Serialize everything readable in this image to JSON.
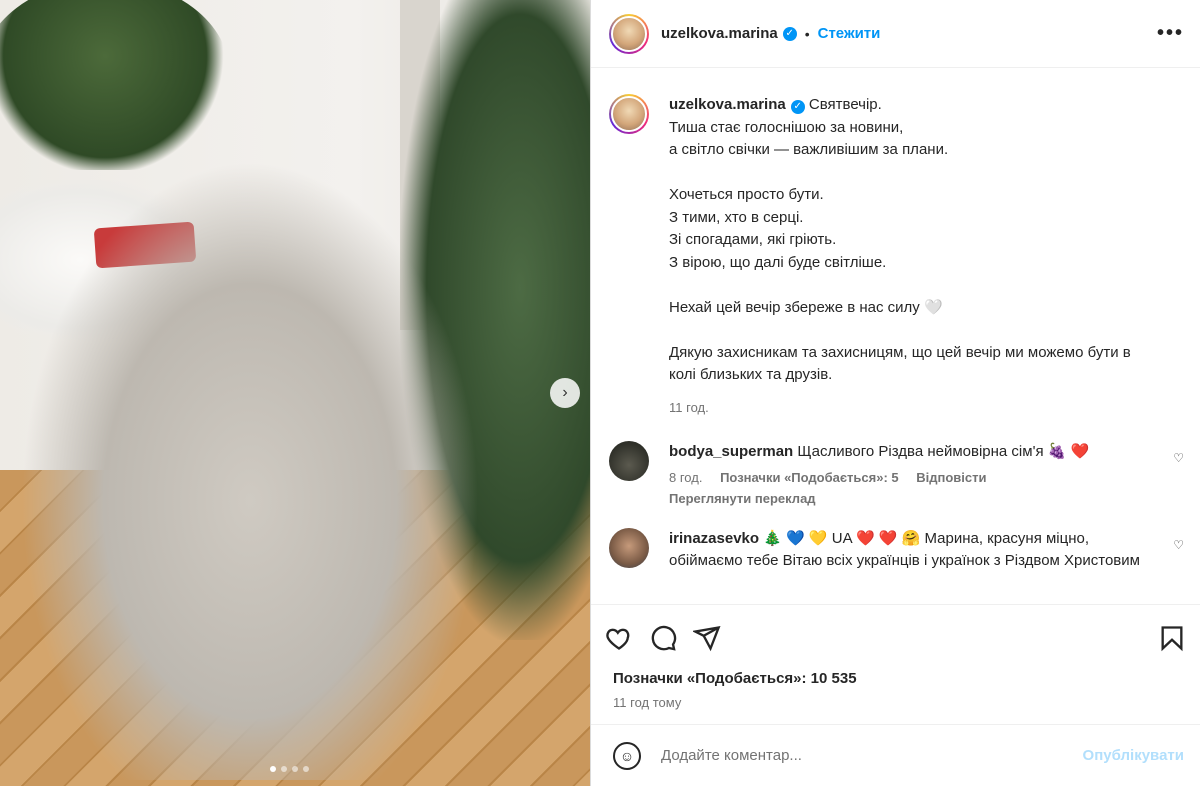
{
  "post": {
    "username": "uzelkova.marina",
    "follow_label": "Стежити",
    "separator": "•",
    "more_label": "•••",
    "caption_first": "Святвечір.",
    "caption_rest": "Тиша стає голоснішою за новини,\nа світло свічки — важливішим за плани.\n\nХочеться просто бути.\nЗ тими, хто в серці.\nЗі спогадами, які гріють.\nЗ вірою, що далі буде світліше.\n\nНехай цей вечір збереже в нас силу 🤍\n\nДякую захисникам та захисницям, що цей вечір ми можемо бути в колі близьких та друзів.",
    "caption_time": "11 год."
  },
  "comments": [
    {
      "username": "bodya_superman",
      "text": "Щасливого Різдва неймовірна сім'я 🍇 ❤️",
      "time": "8 год.",
      "likes": "Позначки «Подобається»: 5",
      "reply": "Відповісти",
      "translate": "Переглянути переклад"
    },
    {
      "username": "irinazasevko",
      "text": "🎄 💙 💛 UA ❤️ ❤️ 🤗 Марина, красуня міцно, обіймаємо тебе Вітаю всіх українців і українок з Різдвом Христовим"
    }
  ],
  "footer": {
    "likes_label": "Позначки «Подобається»: 10 535",
    "time_ago": "11 год тому",
    "comment_placeholder": "Додайте коментар...",
    "publish_label": "Опублікувати"
  },
  "colors": {
    "accent": "#0095f6",
    "publish_disabled": "#b2dffc"
  },
  "carousel": {
    "slides": 4,
    "active_index": 0
  }
}
